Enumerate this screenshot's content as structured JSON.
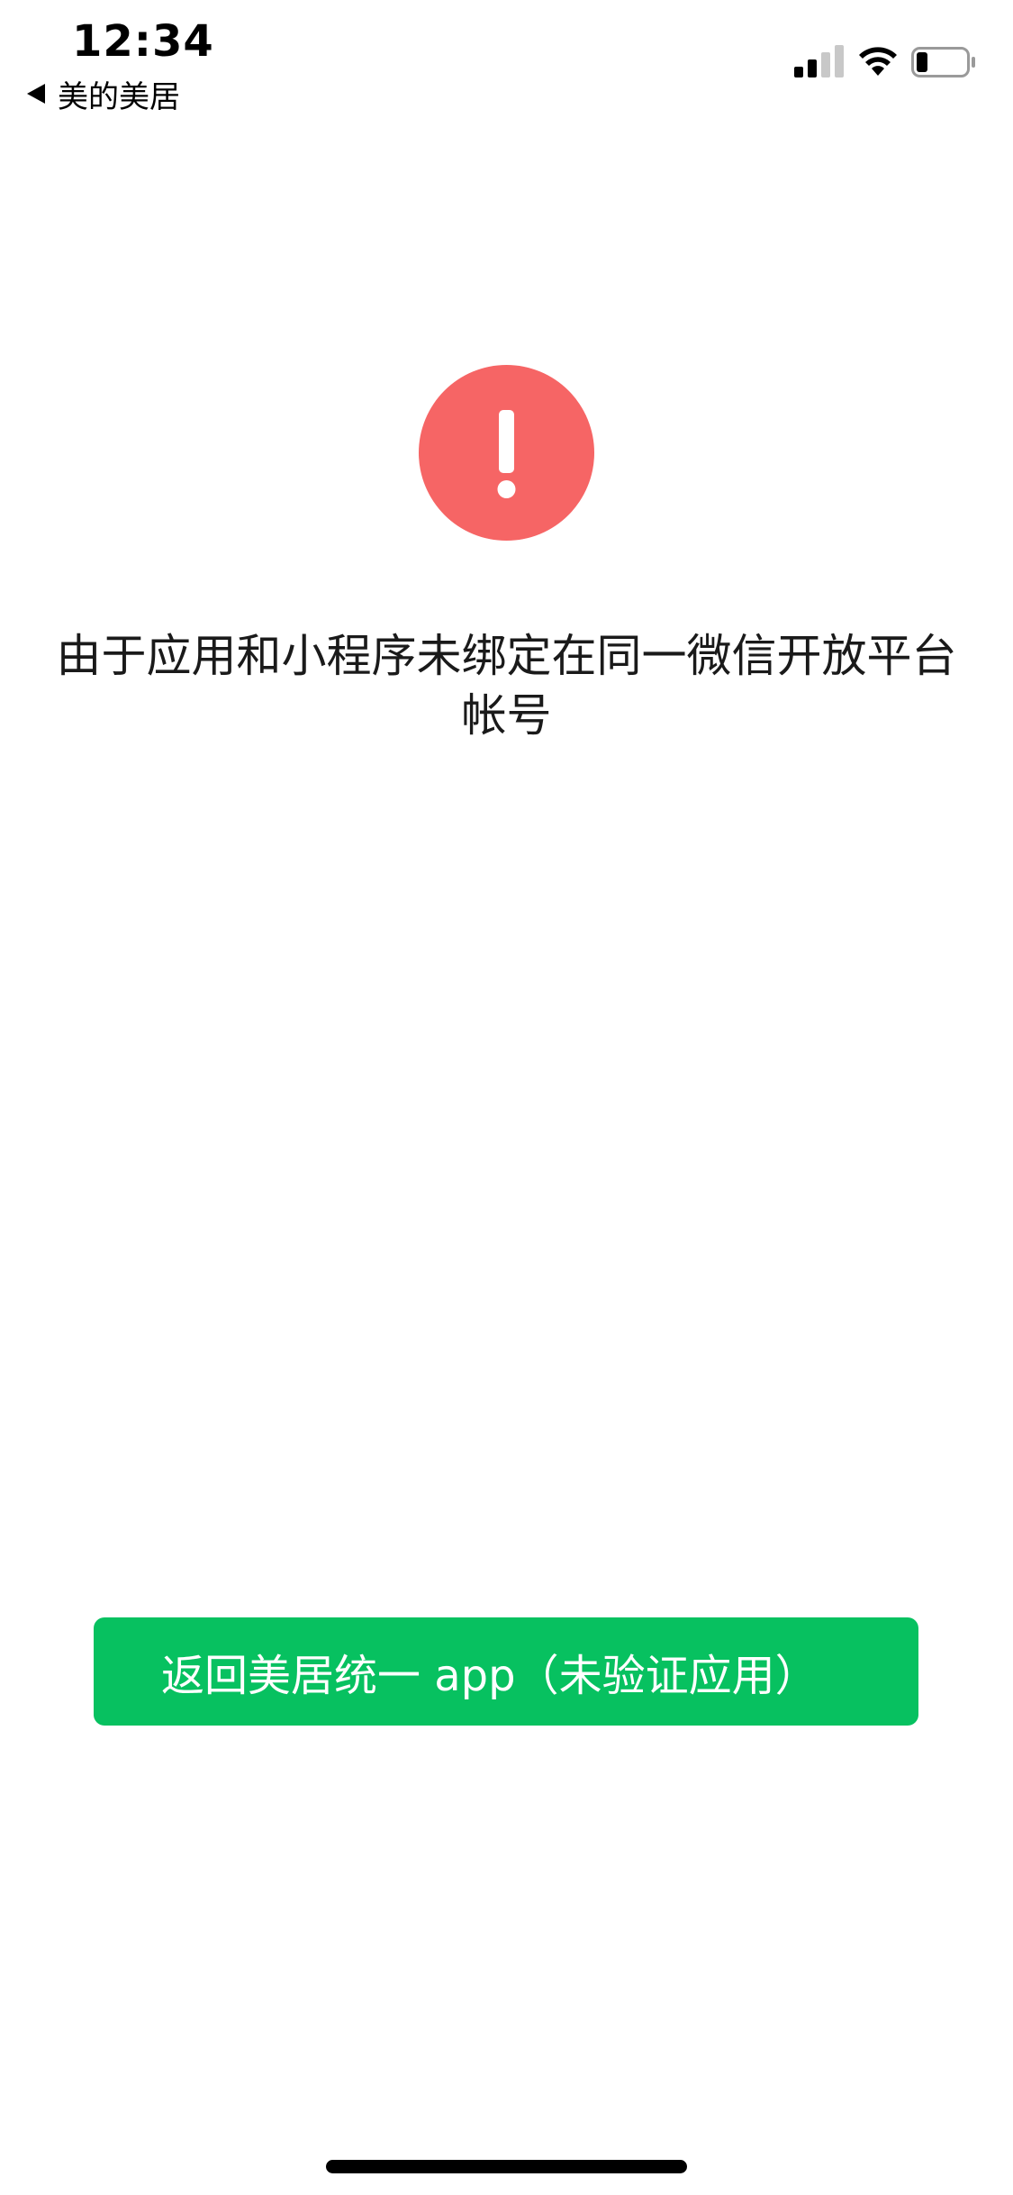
{
  "status_bar": {
    "time": "12:34",
    "back_label": "美的美居",
    "icons": [
      "signal-icon",
      "wifi-icon",
      "battery-icon"
    ]
  },
  "alert": {
    "icon": "exclamation-icon",
    "icon_color": "#f66565",
    "message": "由于应用和小程序未绑定在同一微信开放平台帐号"
  },
  "actions": {
    "return_button_label": "返回美居统一 app（未验证应用）",
    "button_color": "#07c160"
  }
}
